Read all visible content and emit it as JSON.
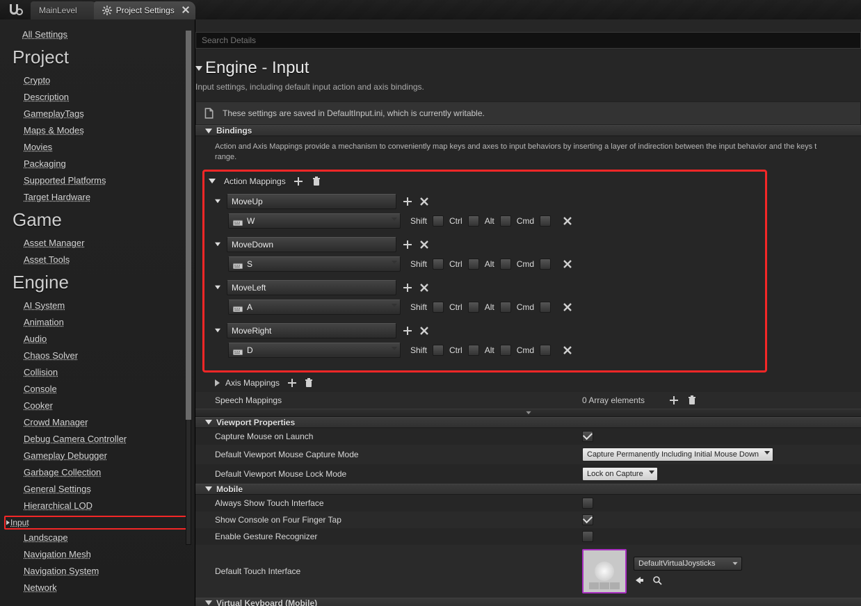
{
  "tabs": {
    "level": "MainLevel",
    "settings": "Project Settings"
  },
  "search_placeholder": "Search Details",
  "header": {
    "title": "Engine - Input",
    "subtitle": "Input settings, including default input action and axis bindings."
  },
  "notice": "These settings are saved in DefaultInput.ini, which is currently writable.",
  "sidebar": {
    "all": "All Settings",
    "groups": [
      {
        "title": "Project",
        "items": [
          "Crypto",
          "Description",
          "GameplayTags",
          "Maps & Modes",
          "Movies",
          "Packaging",
          "Supported Platforms",
          "Target Hardware"
        ]
      },
      {
        "title": "Game",
        "items": [
          "Asset Manager",
          "Asset Tools"
        ]
      },
      {
        "title": "Engine",
        "items": [
          "AI System",
          "Animation",
          "Audio",
          "Chaos Solver",
          "Collision",
          "Console",
          "Cooker",
          "Crowd Manager",
          "Debug Camera Controller",
          "Gameplay Debugger",
          "Garbage Collection",
          "General Settings",
          "Hierarchical LOD",
          "Input",
          "Landscape",
          "Navigation Mesh",
          "Navigation System",
          "Network"
        ]
      }
    ]
  },
  "bindings": {
    "section": "Bindings",
    "desc": "Action and Axis Mappings provide a mechanism to conveniently map keys and axes to input behaviors by inserting a layer of indirection between the input behavior and the keys t\nrange.",
    "action_label": "Action Mappings",
    "axis_label": "Axis Mappings",
    "speech_label": "Speech Mappings",
    "speech_value": "0 Array elements",
    "mods": {
      "shift": "Shift",
      "ctrl": "Ctrl",
      "alt": "Alt",
      "cmd": "Cmd"
    },
    "actions": [
      {
        "name": "MoveUp",
        "key": "W"
      },
      {
        "name": "MoveDown",
        "key": "S"
      },
      {
        "name": "MoveLeft",
        "key": "A"
      },
      {
        "name": "MoveRight",
        "key": "D"
      }
    ]
  },
  "viewport": {
    "section": "Viewport Properties",
    "capture_launch": "Capture Mouse on Launch",
    "capture_mode": "Default Viewport Mouse Capture Mode",
    "capture_mode_val": "Capture Permanently Including Initial Mouse Down",
    "lock_mode": "Default Viewport Mouse Lock Mode",
    "lock_mode_val": "Lock on Capture"
  },
  "mobile": {
    "section": "Mobile",
    "always_touch": "Always Show Touch Interface",
    "four_finger": "Show Console on Four Finger Tap",
    "gesture": "Enable Gesture Recognizer",
    "dti_label": "Default Touch Interface",
    "dti_value": "DefaultVirtualJoysticks"
  },
  "vkm": {
    "section": "Virtual Keyboard (Mobile)"
  }
}
